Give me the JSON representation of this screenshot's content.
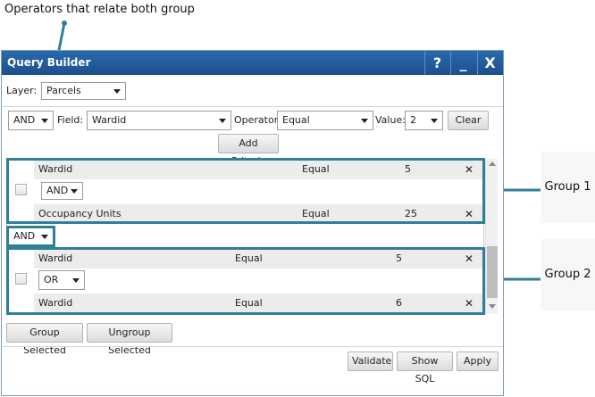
{
  "annotation": {
    "top_callout": "Operators that relate both group",
    "group1": "Group 1",
    "group2": "Group 2"
  },
  "dialog": {
    "title": "Query Builder",
    "help_icon": "?",
    "minimize_icon": "_",
    "close_icon": "X"
  },
  "layer": {
    "label": "Layer:",
    "value": "Parcels"
  },
  "criteria": {
    "join_value": "AND",
    "field_label": "Field:",
    "field_value": "Wardid",
    "operator_label": "Operator:",
    "operator_value": "Equal",
    "value_label": "Value:",
    "value_value": "2",
    "clear_label": "Clear",
    "add_label": "Add Criteria"
  },
  "group1": {
    "rows": [
      {
        "field": "Wardid",
        "operator": "Equal",
        "value": "5"
      },
      {
        "field": "Occupancy Units",
        "operator": "Equal",
        "value": "25"
      }
    ],
    "join": "AND"
  },
  "between_groups": "AND",
  "group2": {
    "rows": [
      {
        "field": "Wardid",
        "operator": "Equal",
        "value": "5"
      },
      {
        "field": "Wardid",
        "operator": "Equal",
        "value": "6"
      }
    ],
    "join": "OR"
  },
  "delete_icon": "✕",
  "buttons": {
    "group_selected": "Group Selected",
    "ungroup_selected": "Ungroup Selected",
    "validate": "Validate",
    "show_sql": "Show SQL",
    "apply": "Apply"
  },
  "colors": {
    "titlebar": "#1c4f8c",
    "annotation": "#2f7f9a"
  }
}
